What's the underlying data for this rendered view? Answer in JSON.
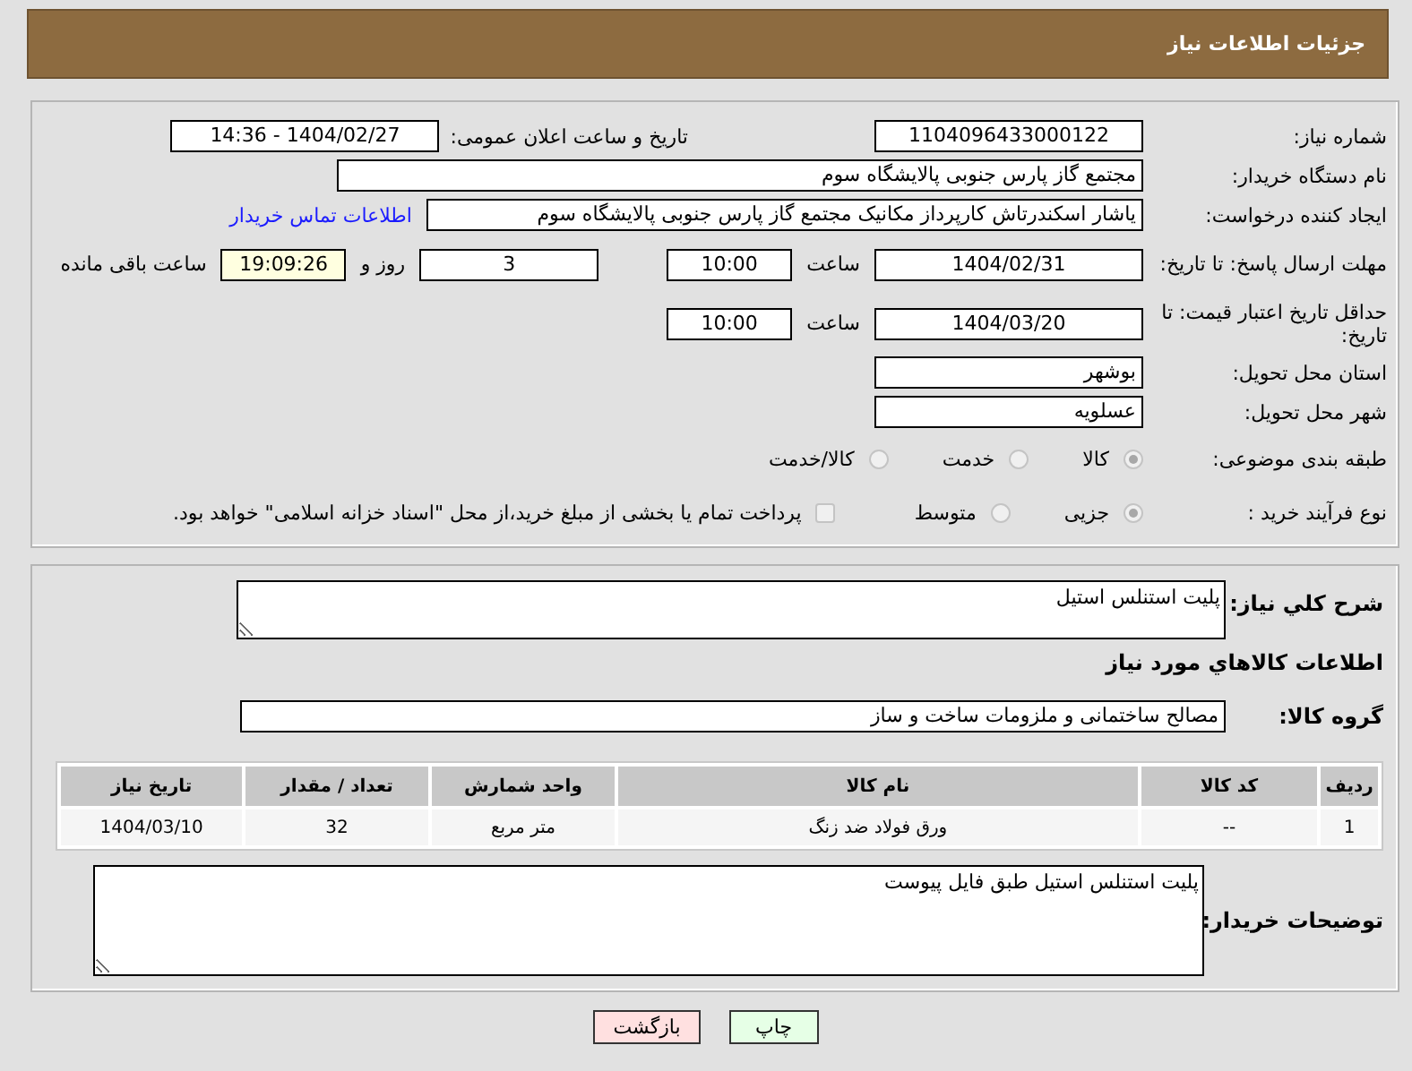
{
  "header": {
    "title": "جزئیات اطلاعات نیاز"
  },
  "details": {
    "need_number": {
      "label": "شماره نیاز:",
      "value": "1104096433000122"
    },
    "announce": {
      "label": "تاریخ و ساعت اعلان عمومی:",
      "value": "1404/02/27 - 14:36"
    },
    "buyer_org": {
      "label": "نام دستگاه خریدار:",
      "value": "مجتمع گاز پارس جنوبی  پالایشگاه سوم"
    },
    "requester": {
      "label": "ایجاد کننده درخواست:",
      "value": "یاشار اسکندرتاش کارپرداز مکانیک مجتمع گاز پارس جنوبی  پالایشگاه سوم",
      "link": "اطلاعات تماس خریدار"
    },
    "deadline": {
      "label": "مهلت ارسال پاسخ: تا تاریخ:",
      "date": "1404/02/31",
      "time_label": "ساعت",
      "time": "10:00",
      "days": "3",
      "days_label": "روز و",
      "remaining": "19:09:26",
      "remaining_label": "ساعت باقی مانده"
    },
    "price_validity": {
      "label": "حداقل تاریخ اعتبار قیمت: تا تاریخ:",
      "date": "1404/03/20",
      "time_label": "ساعت",
      "time": "10:00"
    },
    "province": {
      "label": "استان محل تحویل:",
      "value": "بوشهر"
    },
    "city": {
      "label": "شهر محل تحویل:",
      "value": "عسلویه"
    },
    "category": {
      "label": "طبقه بندی موضوعی:",
      "disabled": true,
      "options": [
        {
          "label": "کالا",
          "selected": true
        },
        {
          "label": "خدمت",
          "selected": false
        },
        {
          "label": "کالا/خدمت",
          "selected": false
        }
      ]
    },
    "process": {
      "label": "نوع فرآیند خرید :",
      "disabled": true,
      "options": [
        {
          "label": "جزیی",
          "selected": true
        },
        {
          "label": "متوسط",
          "selected": false
        }
      ],
      "treasury": {
        "checked": false,
        "text": "پرداخت تمام یا بخشی از مبلغ خرید،از محل \"اسناد خزانه اسلامی\" خواهد بود."
      }
    }
  },
  "description": {
    "label": "شرح کلي نیاز:",
    "value": "پلیت استنلس استیل"
  },
  "goods": {
    "title": "اطلاعات کالاهاي مورد نیاز",
    "group": {
      "label": "گروه کالا:",
      "value": "مصالح ساختمانی و ملزومات ساخت و ساز"
    },
    "table": {
      "columns": [
        "ردیف",
        "کد کالا",
        "نام کالا",
        "واحد شمارش",
        "تعداد / مقدار",
        "تاریخ نیاز"
      ],
      "rows": [
        [
          "1",
          "--",
          "ورق فولاد ضد زنگ",
          "متر مربع",
          "32",
          "1404/03/10"
        ]
      ]
    }
  },
  "buyer_notes": {
    "label": "توضیحات خریدار:",
    "value": "پلیت استنلس استیل طبق فایل پیوست"
  },
  "buttons": [
    {
      "label": "چاپ",
      "kind": "print"
    },
    {
      "label": "بازگشت",
      "kind": "back"
    }
  ]
}
